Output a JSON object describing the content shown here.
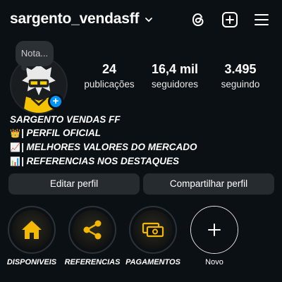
{
  "header": {
    "username": "sargento_vendasff",
    "icons": [
      "chevron-down-icon",
      "threads-icon",
      "create-icon",
      "menu-icon"
    ]
  },
  "note": {
    "text": "Nota..."
  },
  "stats": [
    {
      "value": "24",
      "label": "publicações"
    },
    {
      "value": "16,4 mil",
      "label": "seguidores"
    },
    {
      "value": "3.495",
      "label": "seguindo"
    }
  ],
  "bio": {
    "name": "SARGENTO VENDAS FF",
    "lines": [
      {
        "emoji": "👑",
        "text": "| PERFIL OFICIAL"
      },
      {
        "emoji": "📈",
        "text": "| MELHORES VALORES DO MERCADO"
      },
      {
        "emoji": "📊",
        "text": "| REFERENCIAS NOS DESTAQUES"
      }
    ]
  },
  "buttons": {
    "edit": "Editar perfil",
    "share": "Compartilhar perfil"
  },
  "highlights": [
    {
      "label": "DISPONIVEIS",
      "icon": "home-icon"
    },
    {
      "label": "REFERENCIAS",
      "icon": "share-icon"
    },
    {
      "label": "PAGAMENTOS",
      "icon": "money-icon"
    },
    {
      "label": "Novo",
      "icon": "plus-icon"
    }
  ],
  "colors": {
    "background": "#0b1014",
    "accent": "#f5b800",
    "badge": "#0095f6",
    "button": "#262b30"
  }
}
